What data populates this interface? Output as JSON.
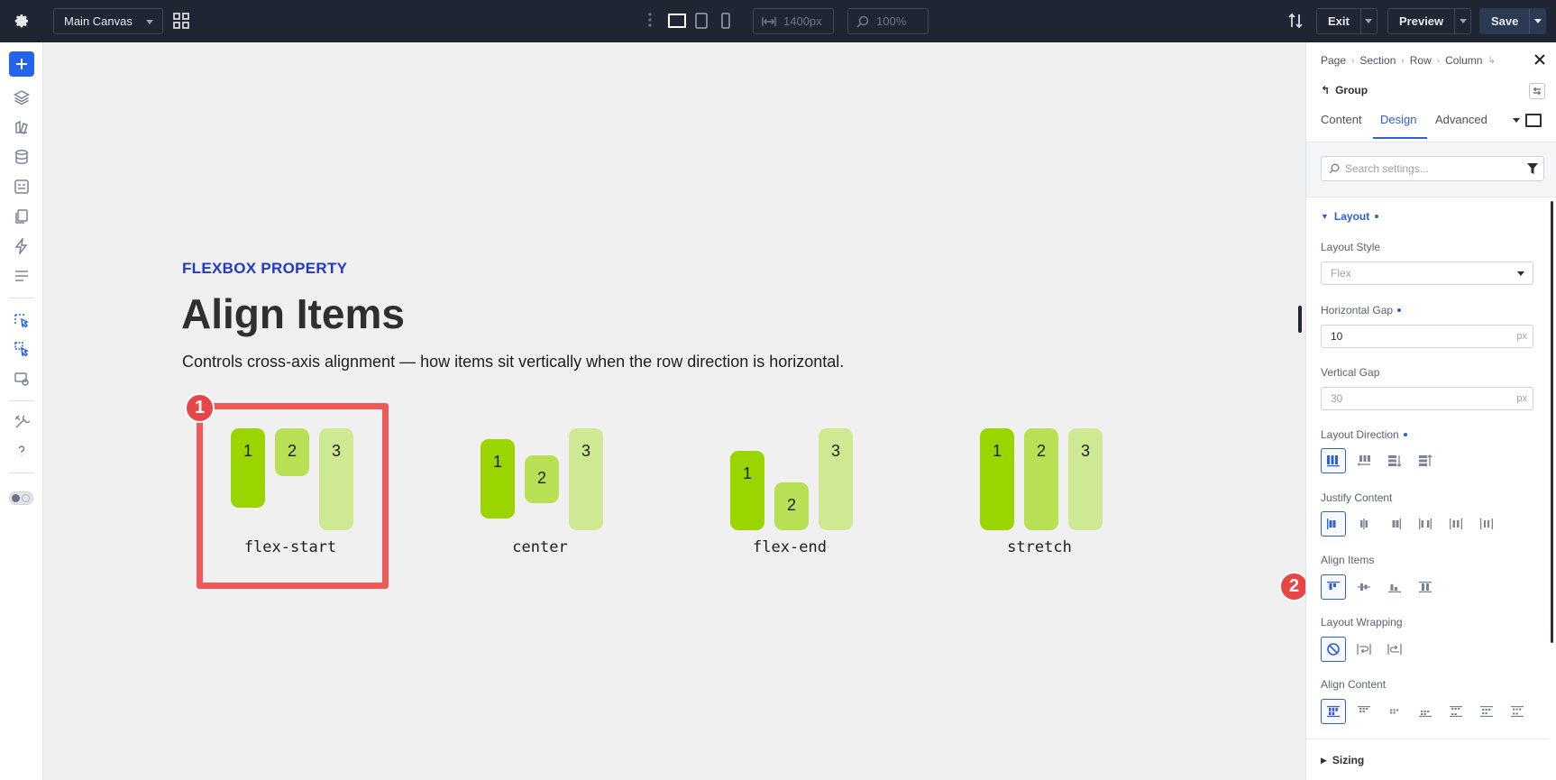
{
  "topbar": {
    "canvas_select": "Main Canvas",
    "width_value": "1400px",
    "zoom_value": "100%",
    "exit_label": "Exit",
    "preview_label": "Preview",
    "save_label": "Save"
  },
  "canvas": {
    "eyebrow": "FLEXBOX PROPERTY",
    "title": "Align Items",
    "description": "Controls cross-axis alignment — how items sit vertically when the row direction is horizontal.",
    "demos": [
      {
        "caption": "flex-start",
        "items": [
          "1",
          "2",
          "3"
        ]
      },
      {
        "caption": "center",
        "items": [
          "1",
          "2",
          "3"
        ]
      },
      {
        "caption": "flex-end",
        "items": [
          "1",
          "2",
          "3"
        ]
      },
      {
        "caption": "stretch",
        "items": [
          "1",
          "2",
          "3"
        ]
      }
    ],
    "badge_1": "1",
    "badge_2": "2"
  },
  "panel": {
    "breadcrumb": [
      "Page",
      "Section",
      "Row",
      "Column"
    ],
    "group_title": "Group",
    "tabs": [
      "Content",
      "Design",
      "Advanced"
    ],
    "active_tab": "Design",
    "search_placeholder": "Search settings...",
    "layout_section": "Layout",
    "layout_style_label": "Layout Style",
    "layout_style_value": "Flex",
    "horizontal_gap_label": "Horizontal Gap",
    "horizontal_gap_value": "10",
    "horizontal_gap_unit": "px",
    "vertical_gap_label": "Vertical Gap",
    "vertical_gap_placeholder": "30",
    "vertical_gap_unit": "px",
    "layout_direction_label": "Layout Direction",
    "justify_content_label": "Justify Content",
    "align_items_label": "Align Items",
    "layout_wrapping_label": "Layout Wrapping",
    "align_content_label": "Align Content",
    "sizing_section": "Sizing"
  },
  "colors": {
    "accent": "#2f5fd0",
    "highlight": "#ee5a5a",
    "item_1": "#9bd500",
    "item_2": "#b8e055",
    "item_3": "#cfe892"
  }
}
